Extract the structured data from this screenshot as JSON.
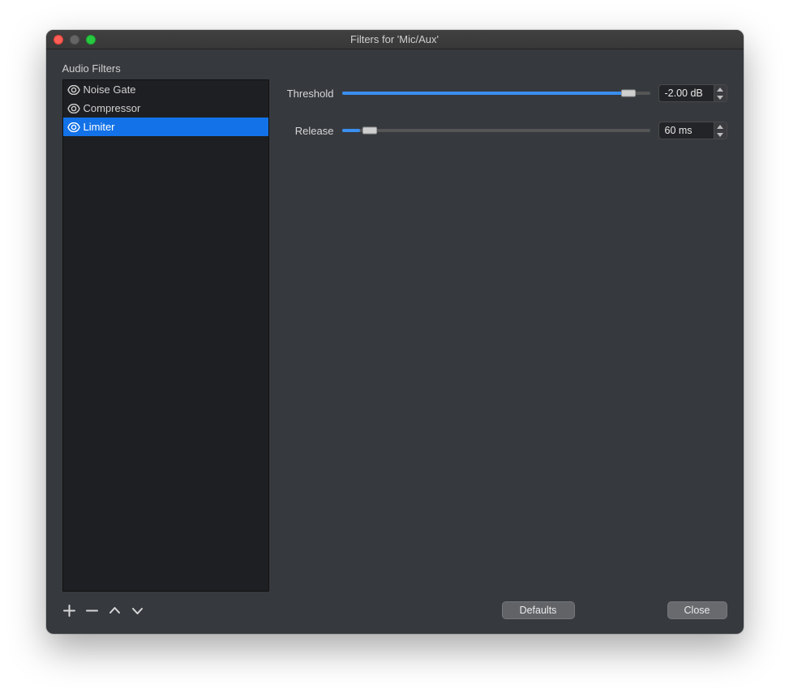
{
  "window": {
    "title": "Filters for 'Mic/Aux'"
  },
  "section": {
    "title": "Audio Filters"
  },
  "filters": [
    {
      "label": "Noise Gate",
      "selected": false
    },
    {
      "label": "Compressor",
      "selected": false
    },
    {
      "label": "Limiter",
      "selected": true
    }
  ],
  "properties": {
    "threshold": {
      "label": "Threshold",
      "value_text": "-2.00 dB",
      "percent": 93
    },
    "release": {
      "label": "Release",
      "value_text": "60 ms",
      "percent": 6
    }
  },
  "buttons": {
    "defaults": "Defaults",
    "close": "Close"
  },
  "icons": {
    "eye": "eye-icon",
    "plus": "plus-icon",
    "minus": "minus-icon",
    "move_up": "chevron-up-icon",
    "move_down": "chevron-down-icon",
    "spin_up": "spin-up-icon",
    "spin_down": "spin-down-icon"
  },
  "colors": {
    "selection": "#1372e7",
    "slider_fill": "#3a8ff0",
    "panel_bg": "#36393e",
    "list_bg": "#1e1f22"
  }
}
